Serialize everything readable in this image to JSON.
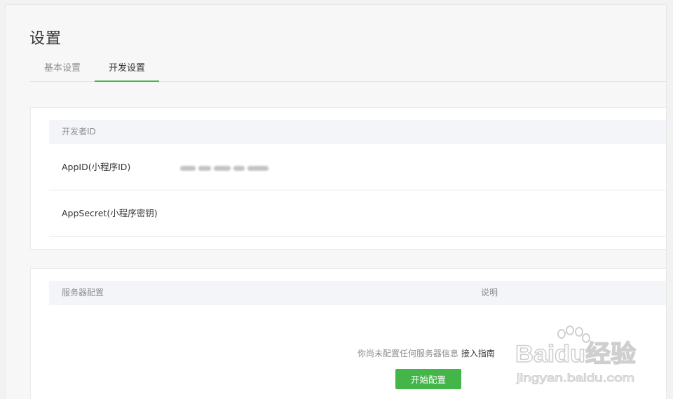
{
  "page": {
    "title": "设置"
  },
  "tabs": [
    {
      "label": "基本设置",
      "active": false
    },
    {
      "label": "开发设置",
      "active": true
    }
  ],
  "developer_id": {
    "header": "开发者ID",
    "rows": [
      {
        "label": "AppID(小程序ID)",
        "value_blurred": true
      },
      {
        "label": "AppSecret(小程序密钥)"
      }
    ]
  },
  "server_config": {
    "header_left": "服务器配置",
    "header_right": "说明",
    "empty_text": "你尚未配置任何服务器信息",
    "guide_link": "接入指南",
    "start_button": "开始配置"
  },
  "watermark": {
    "brand": "Baidu经验",
    "url": "jingyan.baidu.com"
  },
  "colors": {
    "accent": "#44b549",
    "muted_text": "#8d8d8d",
    "text": "#353535",
    "header_bg": "#f4f5f9"
  }
}
